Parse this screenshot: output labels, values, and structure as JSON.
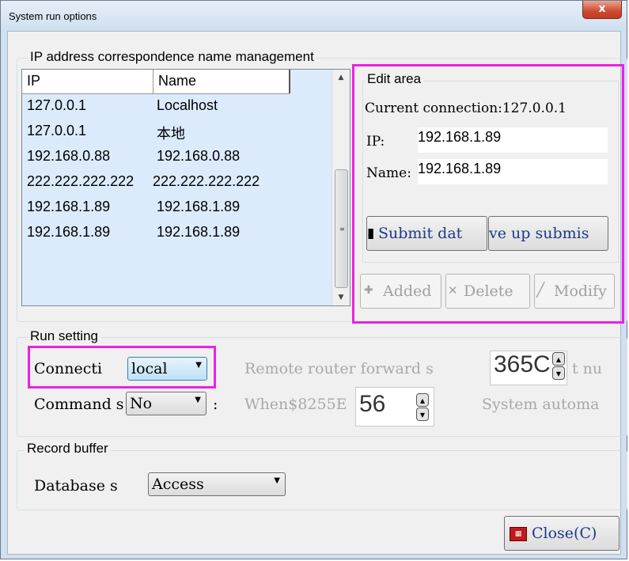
{
  "window": {
    "title": "System run options",
    "close_glyph": "x"
  },
  "ip_group": {
    "label": "IP address correspondence name management",
    "columns": [
      "IP",
      "Name"
    ],
    "rows": [
      {
        "ip": "127.0.0.1",
        "name": "Localhost"
      },
      {
        "ip": "127.0.0.1",
        "name": "本地"
      },
      {
        "ip": "192.168.0.88",
        "name": "192.168.0.88"
      },
      {
        "ip": "222.222.222.222",
        "name": "222.222.222.222"
      },
      {
        "ip": "192.168.1.89",
        "name": "192.168.1.89"
      },
      {
        "ip": "192.168.1.89",
        "name": "192.168.1.89"
      }
    ]
  },
  "edit_area": {
    "label": "Edit area",
    "current_connection": "Current connection:127.0.0.1",
    "ip_label": "IP:",
    "ip_value": "192.168.1.89",
    "name_label": "Name:",
    "name_value": "192.168.1.89",
    "submit_label": "Submit dat",
    "save_label": "ve up submis",
    "added_label": "Added",
    "delete_label": "Delete",
    "modify_label": "Modify"
  },
  "run_setting": {
    "label": "Run setting",
    "connection_label": "Connecti",
    "connection_value": "local",
    "remote_text": "Remote router forward s",
    "remote_value": "365C",
    "remote_suffix": "t nu",
    "command_label": "Command s",
    "command_value": "No",
    "command_colon": ":",
    "when_text": "When$8255E",
    "when_value": "56",
    "system_text": "System automa"
  },
  "record_buffer": {
    "label": "Record buffer",
    "database_label": "Database s",
    "database_value": "Access"
  },
  "footer": {
    "close_label": "Close(C)"
  },
  "colors": {
    "highlight": "#ea22e0",
    "list_bg": "#dcebfc",
    "button_text": "#1c3a8a"
  }
}
